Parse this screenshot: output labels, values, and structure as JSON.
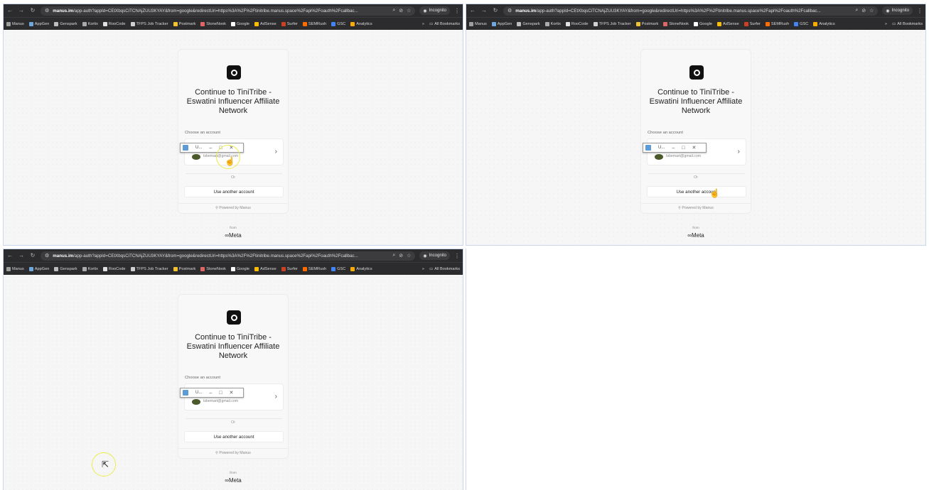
{
  "browser": {
    "url_domain": "manus.im",
    "url_rest": "/app-auth?appId=CEtXbqsCiTCNAjZUU3KYAY&from=google&redirectUri=https%3A%2F%2Ftinitribe.manus.space%2Fapi%2Foauth%2Fcallbac...",
    "incognito_label": "Incognito",
    "icons": {
      "back": "back-arrow-icon",
      "forward": "forward-arrow-icon",
      "reload": "reload-icon",
      "zoom": "zoom-icon",
      "eye_off": "eye-off-icon",
      "star": "star-icon",
      "menu": "kebab-menu-icon"
    },
    "bookmarks": [
      {
        "label": "Manus",
        "color": "#9e9e9e"
      },
      {
        "label": "AppGen",
        "color": "#6fa8dc"
      },
      {
        "label": "Genspark",
        "color": "#bdbdbd"
      },
      {
        "label": "Kortix",
        "color": "#aaaaaa"
      },
      {
        "label": "RooCode",
        "color": "#e0e0e0"
      },
      {
        "label": "TFPS Job Tracker",
        "color": "#d0d0d0"
      },
      {
        "label": "Postmark",
        "color": "#f1c232"
      },
      {
        "label": "StoneNook",
        "color": "#e06666"
      },
      {
        "label": "Google",
        "color": "#ffffff"
      },
      {
        "label": "AdSense",
        "color": "#fbbc04"
      },
      {
        "label": "Surfer",
        "color": "#cc4125"
      },
      {
        "label": "SEMRush",
        "color": "#ff6d00"
      },
      {
        "label": "GSC",
        "color": "#4285f4"
      },
      {
        "label": "Analytics",
        "color": "#f9ab00"
      }
    ],
    "more_label": "»",
    "all_bookmarks_label": "All Bookmarks"
  },
  "auth": {
    "title": "Continue to TiniTribe - Eswatini Influencer Affiliate Network",
    "choose_label": "Choose an account",
    "account_email": "tsbemart@gmail.com",
    "popup_title": "U...",
    "or_label": "Or",
    "alt_button": "Use another account",
    "powered_label": "Powered by Manus",
    "from_label": "from",
    "meta_label": "∞Meta"
  }
}
